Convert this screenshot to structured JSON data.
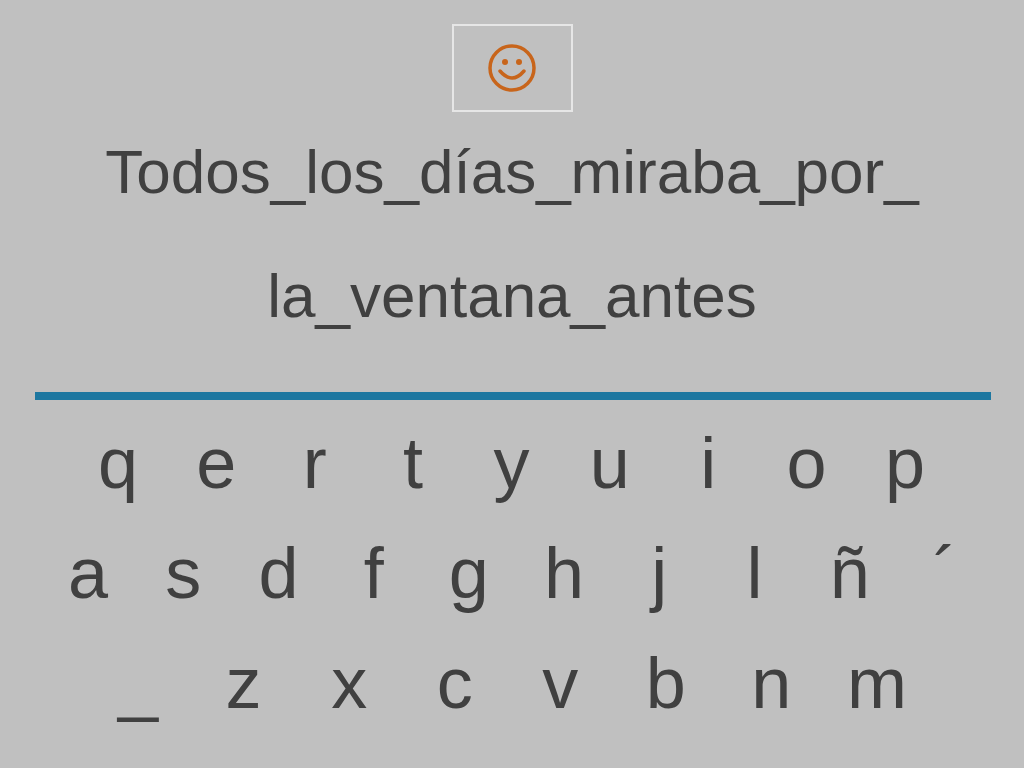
{
  "sentence_lines": [
    "Todos_los_días_miraba_por_",
    "la_ventana_antes"
  ],
  "keyboard": {
    "rows": [
      [
        "q",
        "e",
        "r",
        "t",
        "y",
        "u",
        "i",
        "o",
        "p"
      ],
      [
        "a",
        "s",
        "d",
        "f",
        "g",
        "h",
        "j",
        "l",
        "ñ",
        "´"
      ],
      [
        "_",
        "z",
        "x",
        "c",
        "v",
        "b",
        "n",
        "m"
      ]
    ]
  }
}
